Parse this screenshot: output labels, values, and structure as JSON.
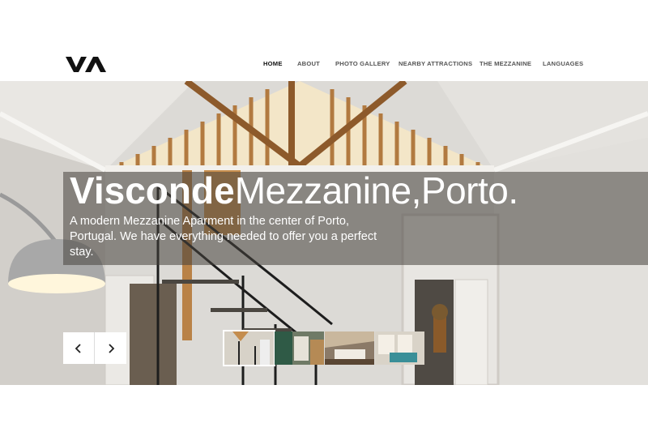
{
  "brand": {
    "logo_text": "VA"
  },
  "nav": {
    "items": [
      {
        "label": "HOME",
        "active": true
      },
      {
        "label": "ABOUT",
        "active": false
      },
      {
        "label": "PHOTO GALLERY",
        "active": false
      },
      {
        "label": "NEARBY ATTRACTIONS",
        "active": false
      },
      {
        "label": "THE MEZZANINE",
        "active": false
      },
      {
        "label": "LANGUAGES",
        "active": false
      }
    ]
  },
  "hero": {
    "title_bold": "Visconde",
    "title_light": "Mezzanine,Porto.",
    "subtitle": "A modern Mezzanine Aparment in the center of Porto, Portugal. We have everything needed to offer you a perfect stay.",
    "prev_icon": "chevron-left-icon",
    "next_icon": "chevron-right-icon"
  },
  "slider": {
    "thumbnails": [
      {
        "name": "thumb-staircase",
        "active": true,
        "color": "#b7a890"
      },
      {
        "name": "thumb-kitchen",
        "active": false,
        "color": "#5f6f5a"
      },
      {
        "name": "thumb-bedroom",
        "active": false,
        "color": "#7a6a5a"
      },
      {
        "name": "thumb-living",
        "active": false,
        "color": "#4a8a90"
      }
    ]
  },
  "colors": {
    "overlay": "#46413c",
    "wood": "#a8753f",
    "accent": "#111111"
  }
}
